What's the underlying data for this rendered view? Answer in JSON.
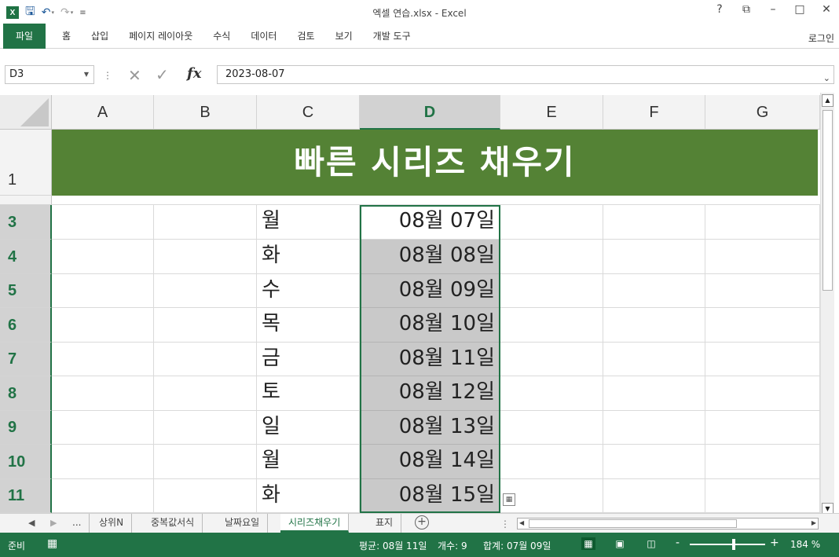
{
  "titlebar": {
    "title": "엑셀 연습.xlsx - Excel",
    "controls": [
      "?",
      "⧉",
      "–",
      "□",
      "✕"
    ]
  },
  "ribbon": {
    "file": "파일",
    "tabs": [
      "홈",
      "삽입",
      "페이지 레이아웃",
      "수식",
      "데이터",
      "검토",
      "보기",
      "개발 도구"
    ],
    "login": "로그인"
  },
  "formula_bar": {
    "name_box": "D3",
    "value": "2023-08-07"
  },
  "columns": [
    "A",
    "B",
    "C",
    "D",
    "E",
    "F",
    "G"
  ],
  "selected_column": "D",
  "banner": {
    "row": "1",
    "text": "빠른 시리즈 채우기"
  },
  "rows": [
    {
      "row": "3",
      "day": "월",
      "date": "08월 07일"
    },
    {
      "row": "4",
      "day": "화",
      "date": "08월 08일"
    },
    {
      "row": "5",
      "day": "수",
      "date": "08월 09일"
    },
    {
      "row": "6",
      "day": "목",
      "date": "08월 10일"
    },
    {
      "row": "7",
      "day": "금",
      "date": "08월 11일"
    },
    {
      "row": "8",
      "day": "토",
      "date": "08월 12일"
    },
    {
      "row": "9",
      "day": "일",
      "date": "08월 13일"
    },
    {
      "row": "10",
      "day": "월",
      "date": "08월 14일"
    },
    {
      "row": "11",
      "day": "화",
      "date": "08월 15일"
    }
  ],
  "sheet_tabs": {
    "more": "...",
    "tabs": [
      "상위N",
      "중복값서식",
      "날짜요일",
      "시리즈채우기",
      "표지"
    ],
    "active": "시리즈채우기"
  },
  "status": {
    "ready": "준비",
    "average": "평균: 08월 11일",
    "count": "개수: 9",
    "sum": "합계: 07월 09일",
    "zoom_minus": "-",
    "zoom_plus": "+",
    "zoom": "184 %"
  },
  "colors": {
    "excel_green": "#217346",
    "banner_green": "#548235"
  }
}
